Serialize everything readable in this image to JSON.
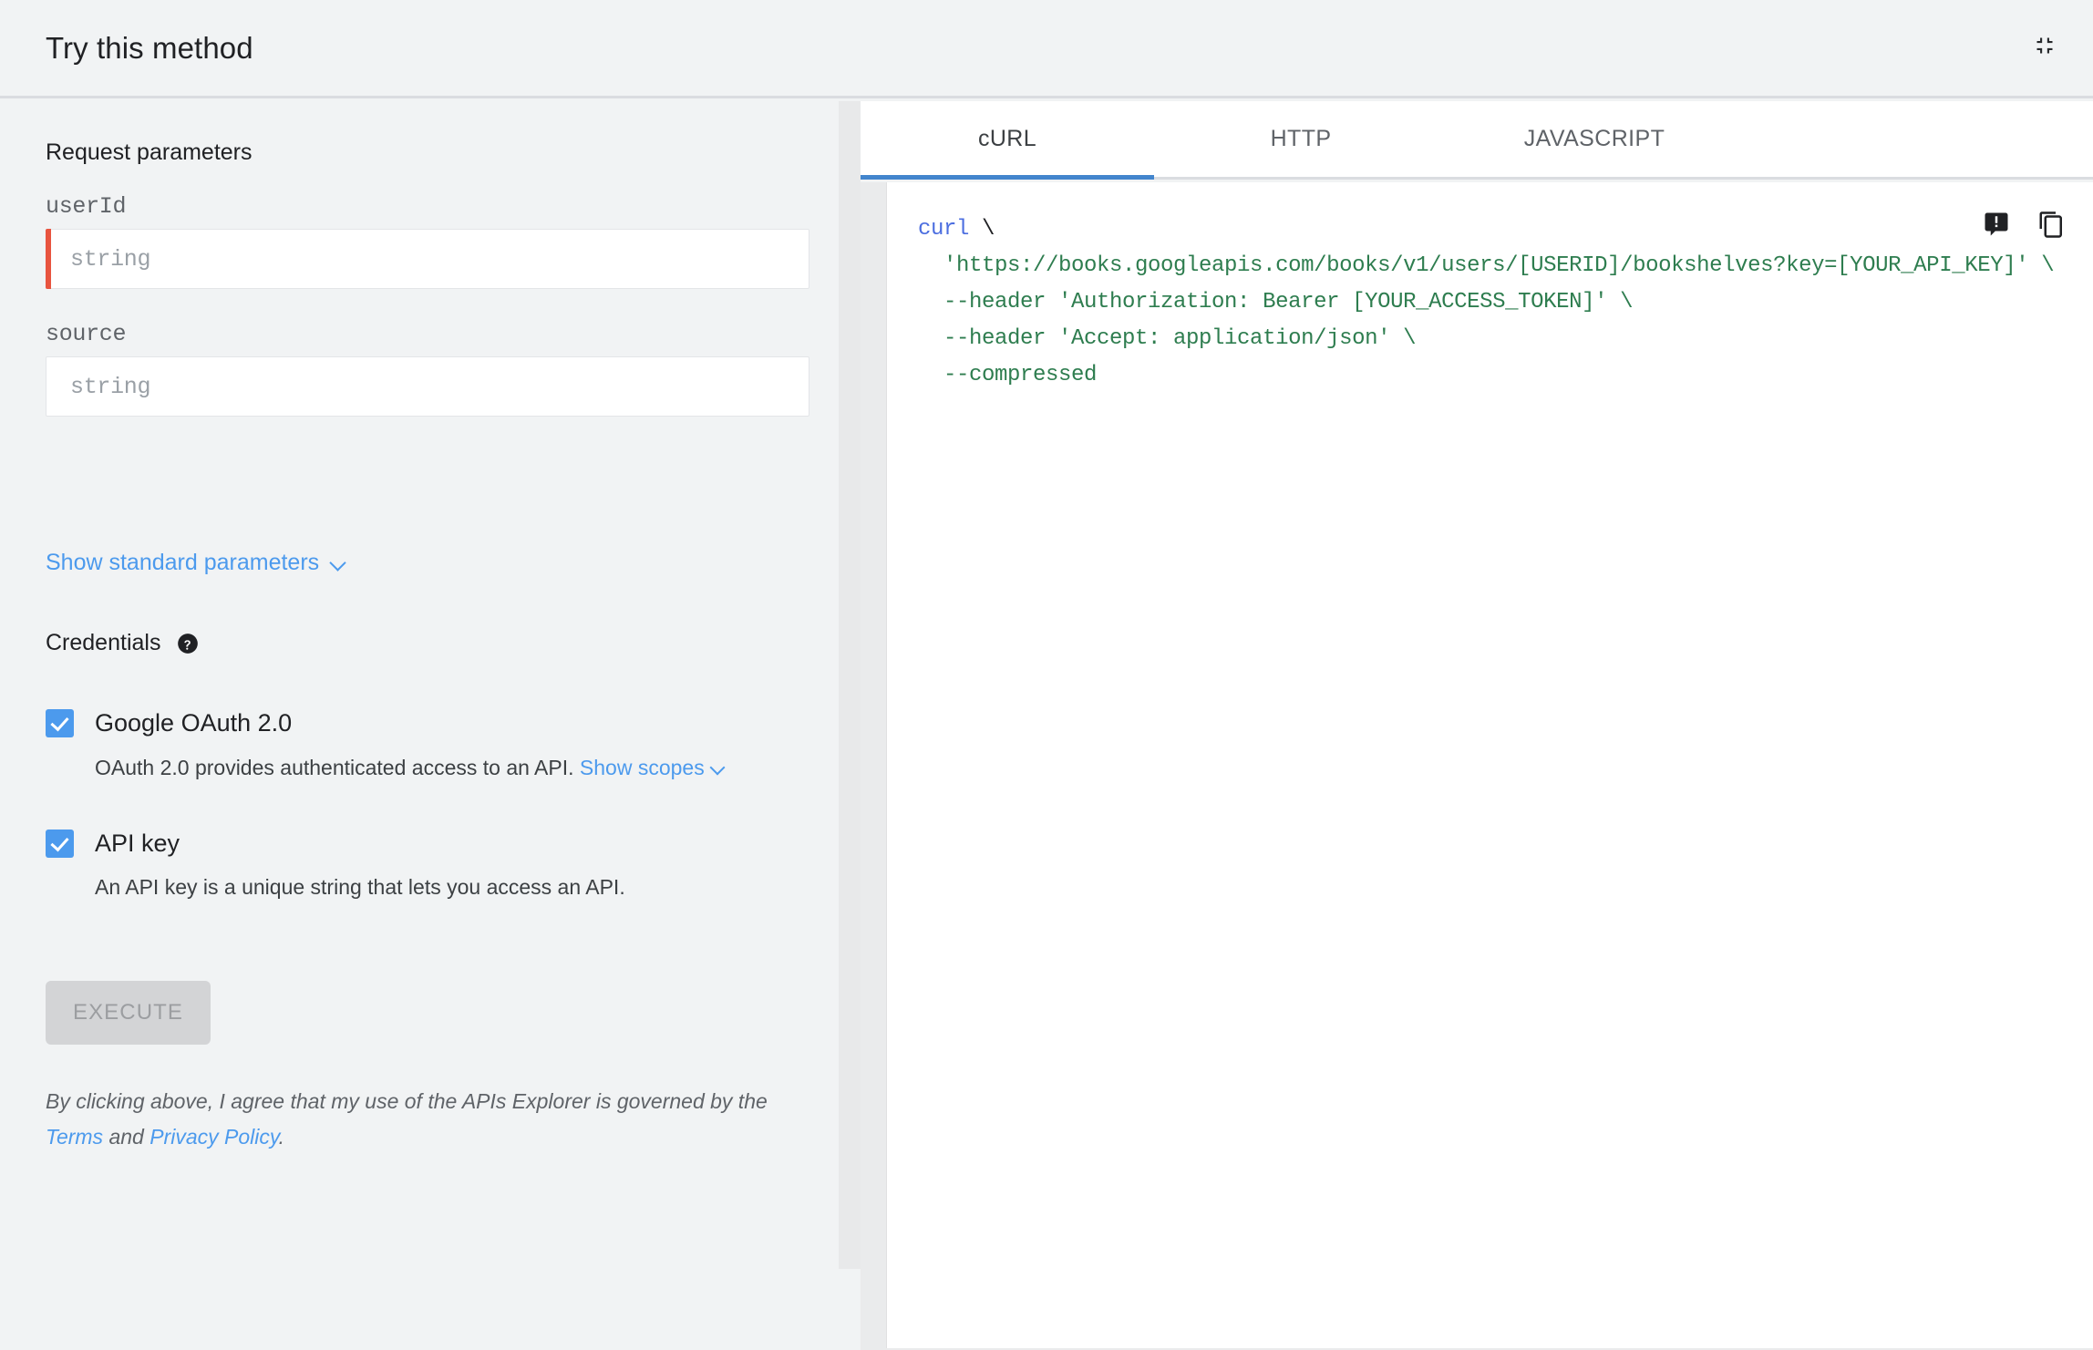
{
  "header": {
    "title": "Try this method",
    "collapse_icon": "collapse-fullscreen-icon"
  },
  "request_parameters": {
    "section_title": "Request parameters",
    "fields": [
      {
        "name": "userId",
        "value": "",
        "placeholder": "string",
        "required": true
      },
      {
        "name": "source",
        "value": "",
        "placeholder": "string",
        "required": false
      }
    ],
    "show_standard_parameters_label": "Show standard parameters",
    "chevron_icon": "chevron-down-icon"
  },
  "credentials": {
    "title": "Credentials",
    "help_icon": "help-circle-icon",
    "items": [
      {
        "label": "Google OAuth 2.0",
        "checked": true,
        "description": "OAuth 2.0 provides authenticated access to an API.",
        "link_label": "Show scopes",
        "has_link": true
      },
      {
        "label": "API key",
        "checked": true,
        "description": "An API key is a unique string that lets you access an API.",
        "link_label": "",
        "has_link": false
      }
    ]
  },
  "execute": {
    "label": "EXECUTE",
    "disabled": true
  },
  "terms": {
    "prefix": "By clicking above, I agree that my use of the APIs Explorer is governed by the ",
    "terms_link": "Terms",
    "middle": " and ",
    "privacy_link": "Privacy Policy",
    "suffix": "."
  },
  "code_panel": {
    "tabs": [
      {
        "label": "cURL",
        "active": true
      },
      {
        "label": "HTTP",
        "active": false
      },
      {
        "label": "JAVASCRIPT",
        "active": false
      }
    ],
    "actions": [
      {
        "name": "report-feedback-icon",
        "title": "Send feedback"
      },
      {
        "name": "copy-icon",
        "title": "Copy"
      }
    ],
    "code_lines": [
      {
        "cmd": "curl",
        "rest": " \\"
      },
      {
        "cmd": "",
        "rest": "  'https://books.googleapis.com/books/v1/users/[USERID]/bookshelves?key=[YOUR_API_KEY]' \\"
      },
      {
        "cmd": "",
        "rest": "  --header 'Authorization: Bearer [YOUR_ACCESS_TOKEN]' \\"
      },
      {
        "cmd": "",
        "rest": "  --header 'Accept: application/json' \\"
      },
      {
        "cmd": "",
        "rest": "  --compressed"
      }
    ]
  },
  "colors": {
    "accent_blue": "#4c9aed",
    "tab_underline": "#4285cd",
    "required_marker": "#e8543f",
    "code_green": "#2e7d4f",
    "code_blue": "#4c6ee0",
    "page_bg": "#f1f3f4"
  }
}
